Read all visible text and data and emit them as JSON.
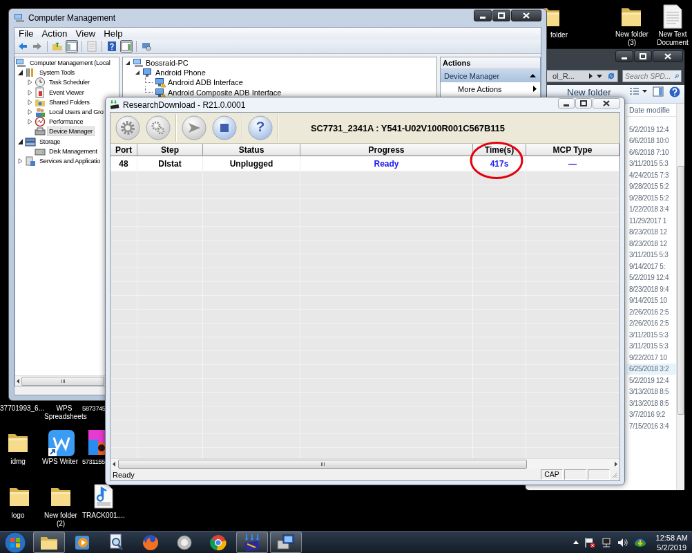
{
  "desktop_icons": [
    {
      "label": "folder",
      "kind": "folder"
    },
    {
      "label": "New folder (3)",
      "kind": "folder"
    },
    {
      "label": "New Text Document",
      "kind": "text-file"
    },
    {
      "label": "37701993_6..."
    },
    {
      "label": "WPS Spreadsheets"
    },
    {
      "label": "5873745"
    },
    {
      "label": "idmg",
      "kind": "folder"
    },
    {
      "label": "WPS Writer",
      "kind": "wps-writer"
    },
    {
      "label": "5731155",
      "kind": "image"
    },
    {
      "label": "logo",
      "kind": "folder"
    },
    {
      "label": "New folder (2)",
      "kind": "folder"
    },
    {
      "label": "TRACK001....",
      "kind": "mp3"
    }
  ],
  "explorer": {
    "address": "ol_R...",
    "search": {
      "placeholder": "Search SPD..."
    },
    "new_folder": "New folder",
    "column": "Date modifie",
    "rows": [
      {
        "text": "5/2/2019 12:4",
        "selected": false
      },
      {
        "text": "6/6/2018 10:0",
        "selected": false
      },
      {
        "text": "6/6/2018 7:10",
        "selected": false
      },
      {
        "text": "3/11/2015 5:3",
        "selected": false
      },
      {
        "text": "4/24/2015 7:3",
        "selected": false
      },
      {
        "text": "9/28/2015 5:2",
        "selected": false
      },
      {
        "text": "9/28/2015 5:2",
        "selected": false
      },
      {
        "text": "1/22/2018 3:4",
        "selected": false
      },
      {
        "text": "11/29/2017 1",
        "selected": false
      },
      {
        "text": "8/23/2018 12",
        "selected": false
      },
      {
        "text": "8/23/2018 12",
        "selected": false
      },
      {
        "text": "3/11/2015 5:3",
        "selected": false
      },
      {
        "text": "9/14/2017 5:",
        "selected": false
      },
      {
        "text": "5/2/2019 12:4",
        "selected": false
      },
      {
        "text": "8/23/2018 9:4",
        "selected": false
      },
      {
        "text": "9/14/2015 10",
        "selected": false
      },
      {
        "text": "2/26/2016 2:5",
        "selected": false
      },
      {
        "text": "2/26/2016 2:5",
        "selected": false
      },
      {
        "text": "3/11/2015 5:3",
        "selected": false
      },
      {
        "text": "3/11/2015 5:3",
        "selected": false
      },
      {
        "text": "9/22/2017 10",
        "selected": false
      },
      {
        "text": "6/25/2018 3:2",
        "selected": true
      },
      {
        "text": "5/2/2019 12:4",
        "selected": false
      },
      {
        "text": "3/13/2018 8:5",
        "selected": false
      },
      {
        "text": "3/13/2018 8:5",
        "selected": false
      },
      {
        "text": "3/7/2016 9:2",
        "selected": false
      },
      {
        "text": "7/15/2016 3:4",
        "selected": false
      }
    ]
  },
  "computer_management": {
    "title": "Computer Management",
    "menu": [
      "File",
      "Action",
      "View",
      "Help"
    ],
    "toolbar": [
      {
        "kind": "back",
        "pressed": false
      },
      {
        "kind": "forward",
        "pressed": false
      },
      {
        "kind": "up",
        "pressed": false
      },
      {
        "kind": "tree-pane",
        "pressed": true
      },
      {
        "kind": "export",
        "pressed": false
      },
      {
        "kind": "help",
        "pressed": false
      },
      {
        "kind": "action-pane",
        "pressed": true
      },
      {
        "kind": "properties",
        "pressed": false
      }
    ],
    "tree": [
      {
        "label": "Computer Management (Local",
        "kind": "computer",
        "selected": false,
        "children": [
          {
            "label": "System Tools",
            "kind": "tools",
            "expandable": true,
            "expanded": true,
            "selected": false,
            "children": [
              {
                "label": "Task Scheduler",
                "kind": "clock",
                "expandable": true,
                "expanded": false,
                "selected": false
              },
              {
                "label": "Event Viewer",
                "kind": "event",
                "expandable": true,
                "expanded": false,
                "selected": false
              },
              {
                "label": "Shared Folders",
                "kind": "share",
                "expandable": true,
                "expanded": false,
                "selected": false
              },
              {
                "label": "Local Users and Gro",
                "kind": "users",
                "expandable": true,
                "expanded": false,
                "selected": false
              },
              {
                "label": "Performance",
                "kind": "performance",
                "expandable": true,
                "expanded": false,
                "selected": false
              },
              {
                "label": "Device Manager",
                "kind": "device",
                "selected": true
              }
            ]
          },
          {
            "label": "Storage",
            "kind": "storage",
            "expandable": true,
            "expanded": true,
            "selected": false,
            "children": [
              {
                "label": "Disk Management",
                "kind": "disk",
                "selected": false
              }
            ]
          },
          {
            "label": "Services and Applicatio",
            "kind": "services",
            "expandable": true,
            "expanded": false,
            "selected": false
          }
        ]
      }
    ],
    "device_tree": [
      {
        "label": "Bossraid-PC",
        "kind": "pc",
        "warning": false,
        "children": [
          {
            "label": "Android Phone",
            "kind": "phone",
            "warning": false,
            "children": [
              {
                "label": "Android ADB Interface",
                "kind": "adb",
                "warning": true
              },
              {
                "label": "Android Composite ADB Interface",
                "kind": "adb",
                "warning": true
              }
            ]
          }
        ]
      }
    ],
    "actions": {
      "title": "Actions",
      "section": "Device Manager",
      "items": [
        "More Actions"
      ]
    }
  },
  "research_download": {
    "title": "ResearchDownload - R21.0.0001",
    "toolbar": [
      {
        "kind": "gear",
        "disabled": true
      },
      {
        "kind": "gears",
        "disabled": true
      },
      {
        "kind": "play",
        "disabled": true
      },
      {
        "kind": "stop",
        "disabled": false
      },
      {
        "kind": "help",
        "label": "?",
        "disabled": false
      }
    ],
    "firmware": "SC7731_2341A : Y541-U02V100R001C567B115",
    "table": {
      "columns": [
        "Port",
        "Step",
        "Status",
        "Progress",
        "Time(s)",
        "MCP Type"
      ],
      "rows": [
        {
          "cells": [
            "48",
            "Dlstat",
            "Unplugged",
            "Ready",
            "417s",
            "—"
          ]
        }
      ]
    },
    "status_bar": {
      "text": "Ready",
      "indicators": [
        "CAP"
      ]
    }
  },
  "taskbar": {
    "apps": [
      {
        "kind": "explorer",
        "active": true
      },
      {
        "kind": "media",
        "active": false
      },
      {
        "kind": "search",
        "active": false
      },
      {
        "kind": "firefox",
        "active": false
      },
      {
        "kind": "tool",
        "active": false
      },
      {
        "kind": "chrome",
        "active": false
      },
      {
        "kind": "flash",
        "active": true
      },
      {
        "kind": "device",
        "active": true
      }
    ],
    "clock": {
      "time": "12:58 AM",
      "date": "5/2/2019"
    }
  }
}
